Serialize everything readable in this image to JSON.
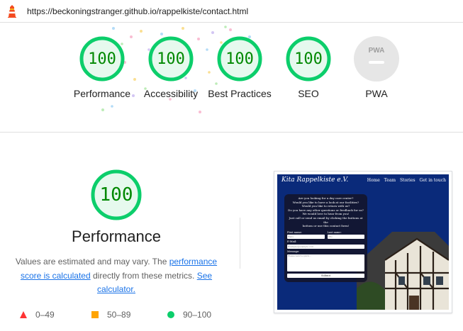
{
  "topbar": {
    "url": "https://beckoningstranger.github.io/rappelkiste/contact.html",
    "logo_icon": "lighthouse-icon"
  },
  "scores": [
    {
      "name": "performance",
      "value": "100",
      "label": "Performance",
      "color": "#0cce6b"
    },
    {
      "name": "accessibility",
      "value": "100",
      "label": "Accessibility",
      "color": "#0cce6b"
    },
    {
      "name": "best-practices",
      "value": "100",
      "label": "Best Practices",
      "color": "#0cce6b"
    },
    {
      "name": "seo",
      "value": "100",
      "label": "SEO",
      "color": "#0cce6b"
    },
    {
      "name": "pwa",
      "value": "PWA",
      "label": "PWA",
      "color": "#9e9e9e"
    }
  ],
  "detail": {
    "score": "100",
    "title": "Performance",
    "desc_before": "Values are estimated and may vary. The ",
    "link_perf": "performance score is calculated",
    "desc_middle": " directly from these metrics. ",
    "link_calc": "See calculator."
  },
  "legend": [
    {
      "range": "0–49",
      "icon": "triangle-icon",
      "color": "#ff3333"
    },
    {
      "range": "50–89",
      "icon": "square-icon",
      "color": "#ffa400"
    },
    {
      "range": "90–100",
      "icon": "circle-icon",
      "color": "#0cce6b"
    }
  ],
  "screenshot": {
    "site_title": "Kita Rappelkiste e.V.",
    "nav": [
      "Home",
      "Team",
      "Stories",
      "Get in touch"
    ],
    "intro_lines": [
      "Are you looking for a day care center?",
      "Would you like to have a look at our facilities?",
      "Would you like to return with us?",
      "Do you have any other questions or feedback for us?",
      "We would love to hear from you!",
      "Just call or send us email by clicking the buttons at the",
      "bottom or use this contact form!"
    ],
    "first_name_label": "First name:",
    "last_name_label": "Last name:",
    "first_name_value": "Hans",
    "last_name_value": "Otto",
    "email_label": "E-Mail:",
    "email_placeholder": "Example@example.com",
    "message_label": "Message:",
    "message_placeholder": "Please send a quick...",
    "submit_label": "Submit"
  }
}
